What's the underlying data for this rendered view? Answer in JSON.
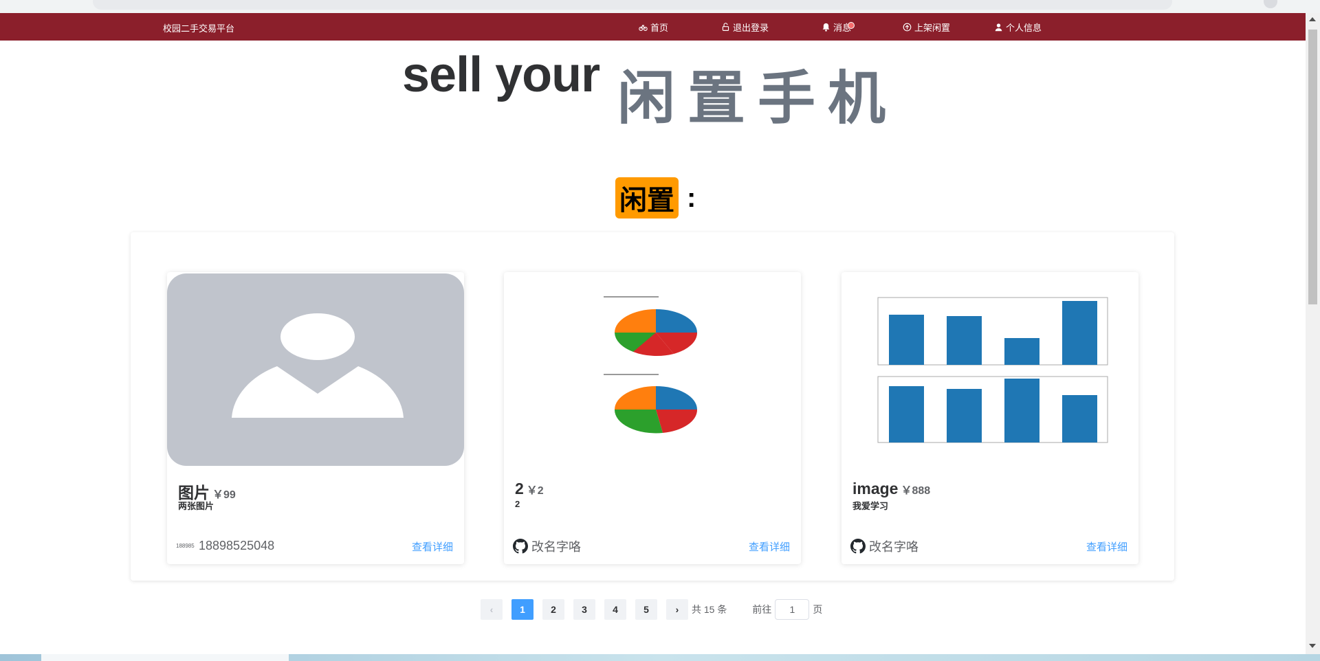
{
  "navbar": {
    "brand": "校园二手交易平台",
    "items": [
      {
        "label": "首页",
        "icon": "bicycle-icon"
      },
      {
        "label": "退出登录",
        "icon": "unlock-icon"
      },
      {
        "label": "消息",
        "icon": "bell-icon"
      },
      {
        "label": "上架闲置",
        "icon": "upload-icon"
      },
      {
        "label": "个人信息",
        "icon": "user-icon"
      }
    ],
    "bg_color": "#8b1f2b"
  },
  "hero": {
    "en": "sell your",
    "cn": "闲置手机"
  },
  "section": {
    "badge": "闲置",
    "colon": ":"
  },
  "cards": [
    {
      "name": "图片",
      "price": "￥99",
      "desc": "两张图片",
      "avatar_text": "188985",
      "owner": "18898525048",
      "link": "查看详细",
      "media": "placeholder-avatar"
    },
    {
      "name": "2",
      "price": "￥2",
      "desc": "2",
      "owner": "改名字咯",
      "owner_icon": "github-icon",
      "link": "查看详细",
      "media": "pie-charts-image"
    },
    {
      "name": "image",
      "price": "￥888",
      "desc": "我爱学习",
      "owner": "改名字咯",
      "owner_icon": "github-icon",
      "link": "查看详细",
      "media": "bar-charts-image"
    }
  ],
  "pagination": {
    "pages": [
      "1",
      "2",
      "3",
      "4",
      "5"
    ],
    "current": "1",
    "total": "共 15 条",
    "goto_prefix": "前往",
    "goto_value": "1",
    "goto_suffix": "页"
  },
  "colors": {
    "accent": "#409eff",
    "badge": "#ff9a00",
    "hero_cn": "#6b7480"
  }
}
